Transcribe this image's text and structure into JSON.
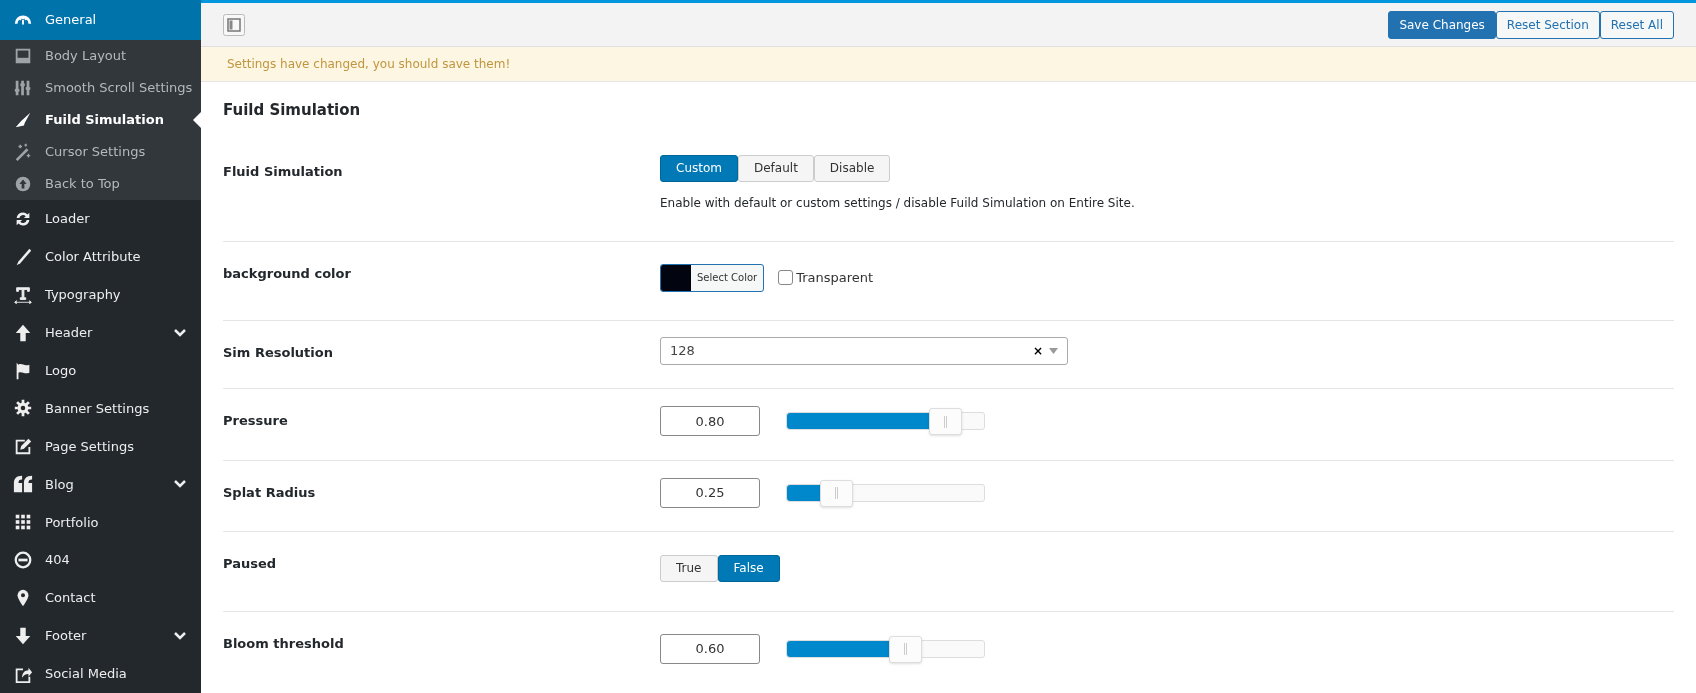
{
  "sidebar": {
    "items": [
      {
        "label": "General",
        "selected": true,
        "has_submenu": false,
        "children": [
          {
            "label": "Body Layout",
            "selected": false
          },
          {
            "label": "Smooth Scroll Settings",
            "selected": false
          },
          {
            "label": "Fuild Simulation",
            "selected": true
          },
          {
            "label": "Cursor Settings",
            "selected": false
          },
          {
            "label": "Back to Top",
            "selected": false
          }
        ]
      },
      {
        "label": "Loader",
        "selected": false,
        "has_submenu": false
      },
      {
        "label": "Color Attribute",
        "selected": false,
        "has_submenu": false
      },
      {
        "label": "Typography",
        "selected": false,
        "has_submenu": false
      },
      {
        "label": "Header",
        "selected": false,
        "has_submenu": true
      },
      {
        "label": "Logo",
        "selected": false,
        "has_submenu": false
      },
      {
        "label": "Banner Settings",
        "selected": false,
        "has_submenu": false
      },
      {
        "label": "Page Settings",
        "selected": false,
        "has_submenu": false
      },
      {
        "label": "Blog",
        "selected": false,
        "has_submenu": true
      },
      {
        "label": "Portfolio",
        "selected": false,
        "has_submenu": false
      },
      {
        "label": "404",
        "selected": false,
        "has_submenu": false
      },
      {
        "label": "Contact",
        "selected": false,
        "has_submenu": false
      },
      {
        "label": "Footer",
        "selected": false,
        "has_submenu": true
      },
      {
        "label": "Social Media",
        "selected": false,
        "has_submenu": false
      }
    ]
  },
  "toolbar": {
    "buttons": [
      {
        "label": "Save Changes",
        "primary": true
      },
      {
        "label": "Reset Section",
        "primary": false
      },
      {
        "label": "Reset All",
        "primary": false
      }
    ]
  },
  "notice": "Settings have changed, you should save them!",
  "section_title": "Fuild Simulation",
  "fields": [
    {
      "kind": "buttonset",
      "label": "Fluid Simulation",
      "options": [
        {
          "label": "Custom",
          "selected": true
        },
        {
          "label": "Default",
          "selected": false
        },
        {
          "label": "Disable",
          "selected": false
        }
      ],
      "description": "Enable with default or custom settings / disable Fuild Simulation on Entire Site."
    },
    {
      "kind": "color",
      "label": "background color",
      "color": "#02050f",
      "button": "Select Color",
      "transparent": {
        "label": "Transparent",
        "checked": false
      }
    },
    {
      "kind": "select",
      "label": "Sim Resolution",
      "value": "128",
      "clear": "×"
    },
    {
      "kind": "slider",
      "label": "Pressure",
      "value": "0.80",
      "level": 0.8
    },
    {
      "kind": "slider",
      "label": "Splat Radius",
      "value": "0.25",
      "level": 0.25
    },
    {
      "kind": "buttonset",
      "label": "Paused",
      "options": [
        {
          "label": "True",
          "selected": false
        },
        {
          "label": "False",
          "selected": true
        }
      ]
    },
    {
      "kind": "slider",
      "label": "Bloom threshold",
      "value": "0.60",
      "level": 0.6
    }
  ]
}
